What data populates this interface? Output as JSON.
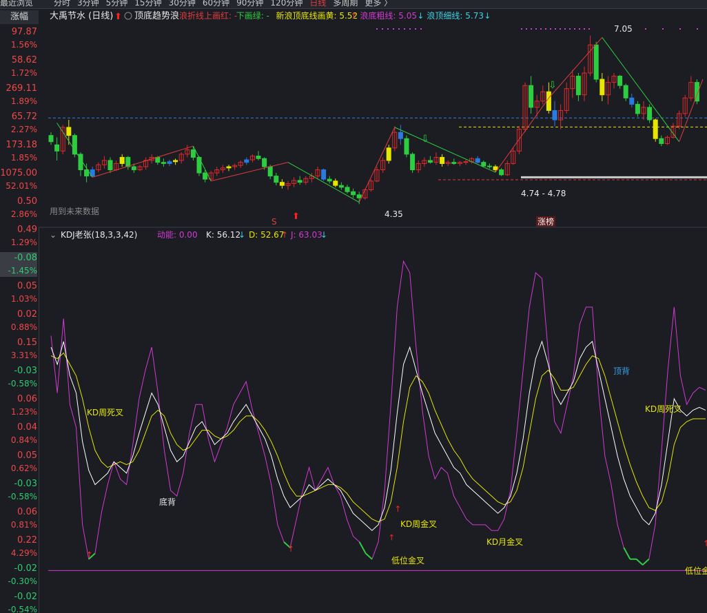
{
  "topbar": {
    "recent_browse": "最近浏览",
    "periods": [
      "分时",
      "3分钟",
      "5分钟",
      "15分钟",
      "30分钟",
      "60分钟",
      "90分钟",
      "120分钟",
      "日线",
      "多周期",
      "更多 〉"
    ],
    "active_period": "日线"
  },
  "sidebar": {
    "header": "涨幅",
    "items": [
      {
        "value": "97.87",
        "pct": "1.56%",
        "color": "red"
      },
      {
        "value": "58.62",
        "pct": "1.72%",
        "color": "red"
      },
      {
        "value": "269.11",
        "pct": "1.89%",
        "color": "red"
      },
      {
        "value": "65.72",
        "pct": "2.27%",
        "color": "red"
      },
      {
        "value": "173.18",
        "pct": "1.85%",
        "color": "red"
      },
      {
        "value": "1075.00",
        "pct": "52.01%",
        "color": "red"
      },
      {
        "value": "0.50",
        "pct": "2.86%",
        "color": "red"
      },
      {
        "value": "0.49",
        "pct": "1.29%",
        "color": "red"
      },
      {
        "value": "-0.08",
        "pct": "-1.45%",
        "color": "green",
        "selected": true
      },
      {
        "value": "0.05",
        "pct": "1.03%",
        "color": "red"
      },
      {
        "value": "0.02",
        "pct": "0.88%",
        "color": "red"
      },
      {
        "value": "0.15",
        "pct": "3.31%",
        "color": "red"
      },
      {
        "value": "-0.03",
        "pct": "-0.58%",
        "color": "green"
      },
      {
        "value": "0.06",
        "pct": "1.23%",
        "color": "red"
      },
      {
        "value": "0.04",
        "pct": "0.84%",
        "color": "red"
      },
      {
        "value": "0.05",
        "pct": "0.62%",
        "color": "red"
      },
      {
        "value": "-0.03",
        "pct": "-0.58%",
        "color": "green"
      },
      {
        "value": "0.06",
        "pct": "0.81%",
        "color": "red"
      },
      {
        "value": "0.22",
        "pct": "4.29%",
        "color": "red"
      },
      {
        "value": "-0.02",
        "pct": "-0.30%",
        "color": "green"
      },
      {
        "value": "-0.02",
        "pct": "-0.54%",
        "color": "green"
      }
    ]
  },
  "price_panel": {
    "title": "大禹节水 (日线)",
    "indicator": "顶底趋势浪",
    "legend": [
      {
        "text": "浪折线上画红: -",
        "color": "#e03c3c"
      },
      {
        "text": "下画绿: -",
        "color": "#2ecc40"
      },
      {
        "text": "新浪顶底线画黄: 5.52",
        "color": "#e6e600",
        "arrow": "↑",
        "arrow_color": "#e03c3c"
      },
      {
        "text": "浪底粗线: 5.05",
        "color": "#d23ad2",
        "arrow": "↓",
        "arrow_color": "#3ad2e6"
      },
      {
        "text": "浪顶细线: 5.73",
        "color": "#3ad2e6",
        "arrow": "↓",
        "arrow_color": "#3ad2e6"
      }
    ],
    "future_data_label": "用到未来数据",
    "annotations": {
      "high": "7.05",
      "low": "4.35",
      "range": "4.74 - 4.78",
      "s_mark": "S",
      "limit_up_list": "涨榜"
    },
    "colors": {
      "up": "#e02a2a",
      "down": "#2ecc40",
      "yellow": "#e6e600",
      "blue": "#2a7ae0",
      "wave_up": "#e03c3c",
      "wave_down": "#2ecc40"
    }
  },
  "kdj_panel": {
    "title": "KDJ老张(18,3,3,42)",
    "momentum": "动能: 0.00",
    "k": "K: 56.12",
    "k_arrow": "↓",
    "d": "D: 52.67",
    "d_arrow": "↑",
    "j": "J: 63.03",
    "j_arrow": "↓",
    "annotations": [
      {
        "text": "KD周死叉",
        "color": "#e6e600"
      },
      {
        "text": "底背",
        "color": "#e8e8e8"
      },
      {
        "text": "KD周金叉",
        "color": "#e6e600"
      },
      {
        "text": "低位金叉",
        "color": "#e6e600"
      },
      {
        "text": "KD月金叉",
        "color": "#e6e600"
      },
      {
        "text": "顶背",
        "color": "#3aa0e6"
      },
      {
        "text": "KD周死叉",
        "color": "#e6e600"
      },
      {
        "text": "低位金",
        "color": "#e6e600"
      }
    ],
    "colors": {
      "k": "#ffffff",
      "d": "#e6e600",
      "j": "#d23ad2",
      "j_low": "#2ecc40",
      "baseline": "#d23ad2",
      "signal": "#ff2020"
    }
  },
  "chart_data": [
    {
      "type": "candlestick",
      "title": "大禹节水 (日线)",
      "y_range": [
        4.35,
        7.05
      ],
      "series": [
        {
          "name": "浪顶细线",
          "values": [
            5.73
          ]
        },
        {
          "name": "浪底粗线",
          "values": [
            5.05
          ]
        },
        {
          "name": "新浪顶底线画黄",
          "values": [
            5.52
          ]
        }
      ],
      "annotations": [
        "7.05",
        "4.35",
        "4.74 - 4.78"
      ],
      "ohlc": [
        [
          5.45,
          5.5,
          5.3,
          5.35
        ],
        [
          5.3,
          5.42,
          5.05,
          5.2
        ],
        [
          5.2,
          5.62,
          5.15,
          5.58
        ],
        [
          5.58,
          5.7,
          5.3,
          5.45
        ],
        [
          5.45,
          5.48,
          5.1,
          5.15
        ],
        [
          5.15,
          5.18,
          4.8,
          4.9
        ],
        [
          4.9,
          5.0,
          4.7,
          4.8
        ],
        [
          4.8,
          4.95,
          4.78,
          4.9
        ],
        [
          4.9,
          5.02,
          4.86,
          4.98
        ],
        [
          4.98,
          5.12,
          4.92,
          5.05
        ],
        [
          5.05,
          5.1,
          4.85,
          4.9
        ],
        [
          4.9,
          5.05,
          4.88,
          5.0
        ],
        [
          5.0,
          5.15,
          4.95,
          5.1
        ],
        [
          5.1,
          5.12,
          4.9,
          4.95
        ],
        [
          4.95,
          5.0,
          4.85,
          4.9
        ],
        [
          4.9,
          4.98,
          4.88,
          4.95
        ],
        [
          4.95,
          5.1,
          4.9,
          5.05
        ],
        [
          5.05,
          5.15,
          5.0,
          5.1
        ],
        [
          5.1,
          5.12,
          4.98,
          5.02
        ],
        [
          5.02,
          5.08,
          4.95,
          5.0
        ],
        [
          5.0,
          5.06,
          4.96,
          5.03
        ],
        [
          5.03,
          5.08,
          4.98,
          5.05
        ],
        [
          5.05,
          5.18,
          5.0,
          5.15
        ],
        [
          5.15,
          5.3,
          5.1,
          5.22
        ],
        [
          5.22,
          5.28,
          5.05,
          5.1
        ],
        [
          5.1,
          5.12,
          4.8,
          4.85
        ],
        [
          4.85,
          4.9,
          4.7,
          4.75
        ],
        [
          4.75,
          4.88,
          4.72,
          4.85
        ],
        [
          4.85,
          4.95,
          4.8,
          4.9
        ],
        [
          4.9,
          4.98,
          4.85,
          4.93
        ],
        [
          4.93,
          4.98,
          4.88,
          4.95
        ],
        [
          4.95,
          5.0,
          4.9,
          4.97
        ],
        [
          4.97,
          5.05,
          4.93,
          5.02
        ],
        [
          5.02,
          5.1,
          4.98,
          5.06
        ],
        [
          5.06,
          5.15,
          5.02,
          5.12
        ],
        [
          5.12,
          5.2,
          5.05,
          5.08
        ],
        [
          5.08,
          5.1,
          4.9,
          4.95
        ],
        [
          4.95,
          4.98,
          4.75,
          4.8
        ],
        [
          4.8,
          4.85,
          4.65,
          4.7
        ],
        [
          4.7,
          4.75,
          4.6,
          4.65
        ],
        [
          4.65,
          4.72,
          4.58,
          4.68
        ],
        [
          4.68,
          4.78,
          4.62,
          4.73
        ],
        [
          4.73,
          4.8,
          4.66,
          4.7
        ],
        [
          4.7,
          4.8,
          4.66,
          4.76
        ],
        [
          4.76,
          4.85,
          4.7,
          4.8
        ],
        [
          4.8,
          4.95,
          4.75,
          4.9
        ],
        [
          4.9,
          4.92,
          4.72,
          4.75
        ],
        [
          4.75,
          4.8,
          4.68,
          4.72
        ],
        [
          4.72,
          4.76,
          4.62,
          4.65
        ],
        [
          4.65,
          4.7,
          4.58,
          4.62
        ],
        [
          4.62,
          4.66,
          4.52,
          4.55
        ],
        [
          4.55,
          4.6,
          4.45,
          4.5
        ],
        [
          4.5,
          4.55,
          4.35,
          4.45
        ],
        [
          4.45,
          4.6,
          4.42,
          4.58
        ],
        [
          4.58,
          4.75,
          4.55,
          4.72
        ],
        [
          4.72,
          4.95,
          4.7,
          4.9
        ],
        [
          4.9,
          5.1,
          4.85,
          5.05
        ],
        [
          5.05,
          5.3,
          5.0,
          5.25
        ],
        [
          5.25,
          5.6,
          5.2,
          5.5
        ],
        [
          5.5,
          5.62,
          5.3,
          5.4
        ],
        [
          5.4,
          5.45,
          5.1,
          5.15
        ],
        [
          5.15,
          5.18,
          4.85,
          4.9
        ],
        [
          4.9,
          5.05,
          4.85,
          5.0
        ],
        [
          5.0,
          5.1,
          4.95,
          5.05
        ],
        [
          5.05,
          5.12,
          5.0,
          5.02
        ],
        [
          5.02,
          5.18,
          4.98,
          5.1
        ],
        [
          5.1,
          5.15,
          4.95,
          5.0
        ],
        [
          5.0,
          5.05,
          4.96,
          5.02
        ],
        [
          5.02,
          5.08,
          4.98,
          5.0
        ],
        [
          5.0,
          5.04,
          4.96,
          5.02
        ],
        [
          5.02,
          5.06,
          4.98,
          5.03
        ],
        [
          5.03,
          5.1,
          5.0,
          5.08
        ],
        [
          5.08,
          5.12,
          5.0,
          5.02
        ],
        [
          5.02,
          5.05,
          4.94,
          4.96
        ],
        [
          4.96,
          5.0,
          4.92,
          4.95
        ],
        [
          4.95,
          4.98,
          4.86,
          4.9
        ],
        [
          4.9,
          4.93,
          4.8,
          4.82
        ],
        [
          4.82,
          5.05,
          4.8,
          5.0
        ],
        [
          5.0,
          5.25,
          4.98,
          5.2
        ],
        [
          5.2,
          5.6,
          5.15,
          5.55
        ],
        [
          5.55,
          6.3,
          5.5,
          6.25
        ],
        [
          6.25,
          6.4,
          5.8,
          5.9
        ],
        [
          5.9,
          6.1,
          5.75,
          6.0
        ],
        [
          6.0,
          6.25,
          5.95,
          6.15
        ],
        [
          6.15,
          6.3,
          5.8,
          5.85
        ],
        [
          5.85,
          6.0,
          5.6,
          5.7
        ],
        [
          5.7,
          5.95,
          5.55,
          5.85
        ],
        [
          5.85,
          6.3,
          5.8,
          6.2
        ],
        [
          6.2,
          6.5,
          6.05,
          6.4
        ],
        [
          6.4,
          6.45,
          6.0,
          6.1
        ],
        [
          6.1,
          6.55,
          6.0,
          6.45
        ],
        [
          6.45,
          7.05,
          6.4,
          6.9
        ],
        [
          6.9,
          6.95,
          6.3,
          6.35
        ],
        [
          6.35,
          6.45,
          6.0,
          6.1
        ],
        [
          6.1,
          6.4,
          5.95,
          6.3
        ],
        [
          6.3,
          6.45,
          6.2,
          6.4
        ],
        [
          6.4,
          6.42,
          6.2,
          6.25
        ],
        [
          6.25,
          6.28,
          6.0,
          6.05
        ],
        [
          6.05,
          6.12,
          5.9,
          5.95
        ],
        [
          5.95,
          6.0,
          5.75,
          5.8
        ],
        [
          5.8,
          6.0,
          5.7,
          5.9
        ],
        [
          5.9,
          5.95,
          5.65,
          5.7
        ],
        [
          5.7,
          5.72,
          5.35,
          5.4
        ],
        [
          5.4,
          5.45,
          5.28,
          5.32
        ],
        [
          5.32,
          5.45,
          5.3,
          5.42
        ],
        [
          5.42,
          5.65,
          5.4,
          5.6
        ],
        [
          5.6,
          5.85,
          5.55,
          5.8
        ],
        [
          5.8,
          6.1,
          5.75,
          6.05
        ],
        [
          6.05,
          6.4,
          6.0,
          6.3
        ],
        [
          6.3,
          6.35,
          5.95,
          6.0
        ]
      ]
    },
    {
      "type": "line",
      "title": "KDJ老张(18,3,3,42)",
      "y_range": [
        -10,
        110
      ],
      "series": [
        {
          "name": "K",
          "values": [
            78,
            72,
            80,
            68,
            62,
            45,
            35,
            30,
            32,
            34,
            38,
            36,
            34,
            40,
            48,
            55,
            62,
            58,
            50,
            42,
            38,
            40,
            45,
            50,
            52,
            48,
            44,
            46,
            48,
            52,
            55,
            58,
            54,
            50,
            46,
            40,
            32,
            26,
            22,
            24,
            26,
            30,
            28,
            30,
            32,
            30,
            28,
            24,
            20,
            18,
            16,
            14,
            16,
            22,
            35,
            55,
            72,
            78,
            70,
            62,
            55,
            48,
            44,
            40,
            36,
            34,
            30,
            28,
            26,
            24,
            22,
            20,
            22,
            26,
            34,
            46,
            62,
            74,
            80,
            72,
            62,
            58,
            62,
            66,
            74,
            78,
            80,
            70,
            60,
            50,
            40,
            32,
            26,
            22,
            18,
            16,
            20,
            30,
            45,
            60,
            56,
            54,
            56,
            57,
            56
          ]
        },
        {
          "name": "D",
          "values": [
            75,
            74,
            76,
            72,
            68,
            60,
            50,
            42,
            38,
            36,
            37,
            38,
            37,
            38,
            42,
            48,
            54,
            56,
            54,
            48,
            44,
            42,
            43,
            46,
            49,
            49,
            47,
            46,
            47,
            49,
            52,
            54,
            54,
            52,
            49,
            45,
            40,
            34,
            29,
            26,
            26,
            27,
            28,
            29,
            30,
            30,
            29,
            27,
            24,
            22,
            20,
            18,
            17,
            18,
            24,
            36,
            52,
            64,
            68,
            66,
            62,
            56,
            51,
            46,
            42,
            39,
            35,
            32,
            30,
            28,
            26,
            24,
            23,
            24,
            28,
            36,
            48,
            60,
            68,
            70,
            67,
            63,
            63,
            64,
            68,
            72,
            75,
            74,
            68,
            60,
            52,
            44,
            37,
            31,
            26,
            22,
            21,
            24,
            32,
            44,
            50,
            52,
            53,
            53,
            53
          ]
        },
        {
          "name": "J",
          "values": [
            82,
            62,
            88,
            58,
            50,
            16,
            4,
            6,
            20,
            30,
            38,
            32,
            30,
            44,
            60,
            70,
            78,
            62,
            42,
            28,
            26,
            34,
            48,
            58,
            58,
            46,
            38,
            44,
            50,
            58,
            62,
            66,
            56,
            48,
            40,
            30,
            16,
            10,
            8,
            18,
            28,
            36,
            28,
            32,
            36,
            30,
            26,
            18,
            12,
            10,
            6,
            4,
            10,
            28,
            58,
            92,
            108,
            104,
            78,
            56,
            40,
            32,
            36,
            34,
            26,
            22,
            18,
            16,
            16,
            16,
            14,
            14,
            18,
            28,
            48,
            70,
            92,
            104,
            102,
            76,
            52,
            48,
            58,
            68,
            86,
            92,
            92,
            62,
            40,
            30,
            16,
            8,
            4,
            4,
            2,
            4,
            16,
            42,
            70,
            92,
            68,
            58,
            62,
            64,
            63
          ]
        }
      ],
      "annotations": [
        "KD周死叉",
        "底背",
        "KD周金叉",
        "低位金叉",
        "KD月金叉",
        "顶背",
        "KD周死叉",
        "低位金"
      ]
    }
  ]
}
